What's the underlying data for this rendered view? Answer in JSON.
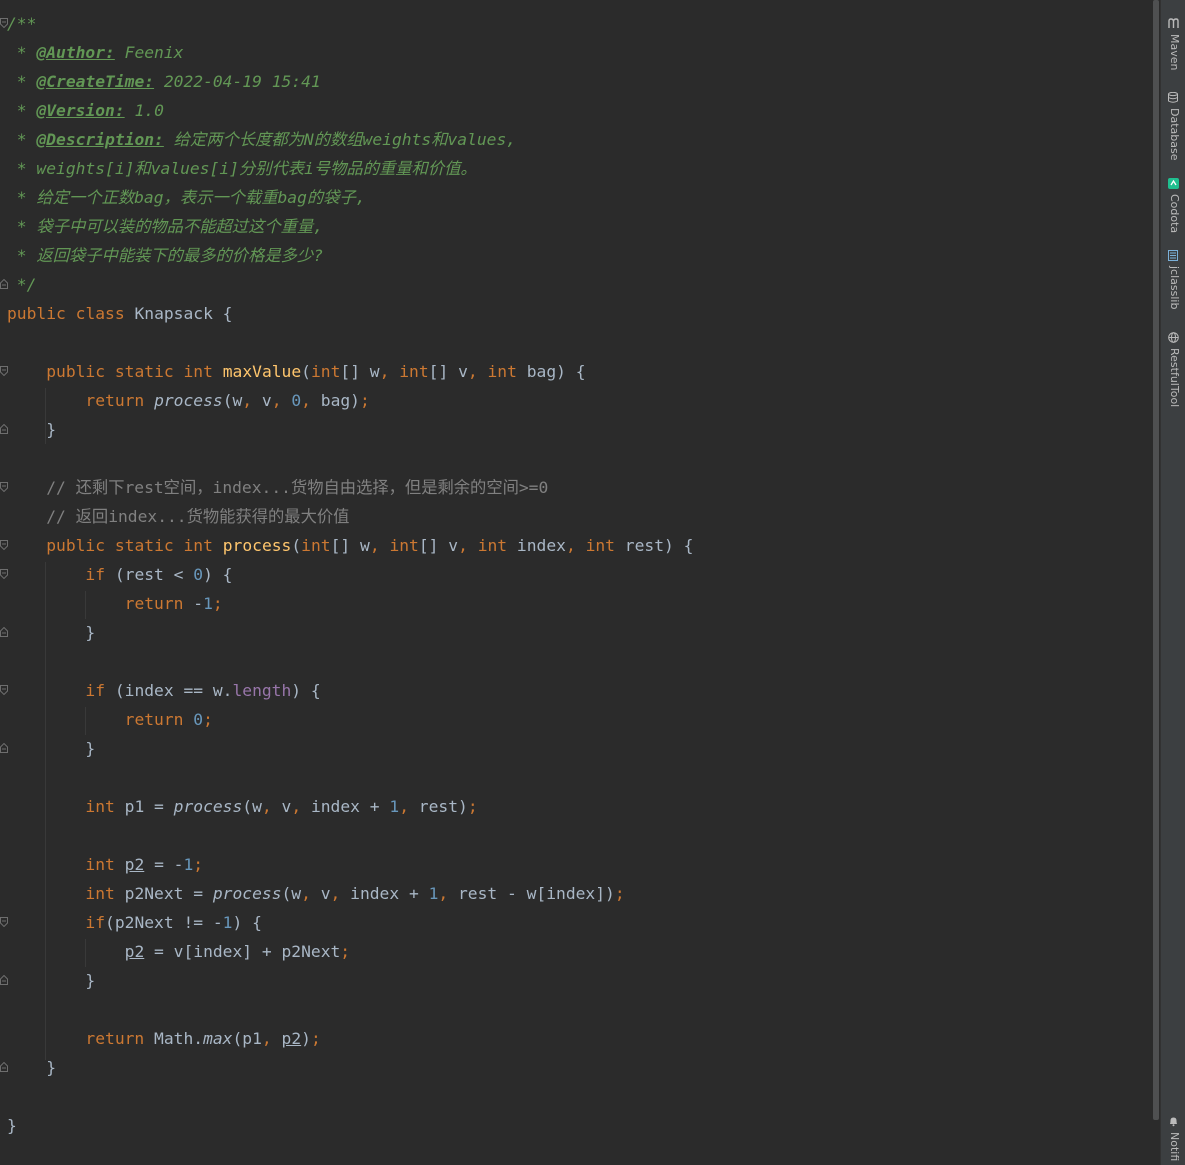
{
  "code": {
    "lines": [
      [
        [
          "/**",
          "doc"
        ]
      ],
      [
        [
          " * ",
          "doc"
        ],
        [
          "@Author:",
          "doctag"
        ],
        [
          " Feenix",
          "doc"
        ]
      ],
      [
        [
          " * ",
          "doc"
        ],
        [
          "@CreateTime:",
          "doctag"
        ],
        [
          " 2022-04-19 15:41",
          "doc"
        ]
      ],
      [
        [
          " * ",
          "doc"
        ],
        [
          "@Version:",
          "doctag"
        ],
        [
          " 1.0",
          "doc"
        ]
      ],
      [
        [
          " * ",
          "doc"
        ],
        [
          "@Description:",
          "doctag"
        ],
        [
          " 给定两个长度都为N的数组weights和values,",
          "doc"
        ]
      ],
      [
        [
          " * weights[i]和values[i]分别代表i号物品的重量和价值。",
          "doc"
        ]
      ],
      [
        [
          " * 给定一个正数bag，表示一个载重bag的袋子,",
          "doc"
        ]
      ],
      [
        [
          " * 袋子中可以装的物品不能超过这个重量,",
          "doc"
        ]
      ],
      [
        [
          " * 返回袋子中能装下的最多的价格是多少?",
          "doc"
        ]
      ],
      [
        [
          " */",
          "doc"
        ]
      ],
      [
        [
          "public",
          "kw"
        ],
        [
          " "
        ],
        [
          "class",
          "kw"
        ],
        [
          " Knapsack {"
        ]
      ],
      [],
      [
        [
          "    "
        ],
        [
          "public",
          "kw"
        ],
        [
          " "
        ],
        [
          "static",
          "kw"
        ],
        [
          " "
        ],
        [
          "int",
          "kw"
        ],
        [
          " "
        ],
        [
          "maxValue",
          "fn"
        ],
        [
          "("
        ],
        [
          "int",
          "kw"
        ],
        [
          "[] w"
        ],
        [
          ",",
          "kw"
        ],
        [
          " "
        ],
        [
          "int",
          "kw"
        ],
        [
          "[] v"
        ],
        [
          ",",
          "kw"
        ],
        [
          " "
        ],
        [
          "int",
          "kw"
        ],
        [
          " bag) {"
        ]
      ],
      [
        [
          "        "
        ],
        [
          "return",
          "kw"
        ],
        [
          " "
        ],
        [
          "process",
          "it"
        ],
        [
          "(w"
        ],
        [
          ",",
          "kw"
        ],
        [
          " v"
        ],
        [
          ",",
          "kw"
        ],
        [
          " "
        ],
        [
          "0",
          "num"
        ],
        [
          ",",
          "kw"
        ],
        [
          " bag)"
        ],
        [
          ";",
          "kw"
        ]
      ],
      [
        [
          "    }"
        ]
      ],
      [],
      [
        [
          "    "
        ],
        [
          "// 还剩下rest空间，index...货物自由选择，但是剩余的空间>=0",
          "cmt"
        ]
      ],
      [
        [
          "    "
        ],
        [
          "// 返回index...货物能获得的最大价值",
          "cmt"
        ]
      ],
      [
        [
          "    "
        ],
        [
          "public",
          "kw"
        ],
        [
          " "
        ],
        [
          "static",
          "kw"
        ],
        [
          " "
        ],
        [
          "int",
          "kw"
        ],
        [
          " "
        ],
        [
          "process",
          "fn"
        ],
        [
          "("
        ],
        [
          "int",
          "kw"
        ],
        [
          "[] w"
        ],
        [
          ",",
          "kw"
        ],
        [
          " "
        ],
        [
          "int",
          "kw"
        ],
        [
          "[] v"
        ],
        [
          ",",
          "kw"
        ],
        [
          " "
        ],
        [
          "int",
          "kw"
        ],
        [
          " index"
        ],
        [
          ",",
          "kw"
        ],
        [
          " "
        ],
        [
          "int",
          "kw"
        ],
        [
          " rest) {"
        ]
      ],
      [
        [
          "        "
        ],
        [
          "if",
          "kw"
        ],
        [
          " (rest < "
        ],
        [
          "0",
          "num"
        ],
        [
          ") {"
        ]
      ],
      [
        [
          "            "
        ],
        [
          "return",
          "kw"
        ],
        [
          " -"
        ],
        [
          "1",
          "num"
        ],
        [
          ";",
          "kw"
        ]
      ],
      [
        [
          "        }"
        ]
      ],
      [],
      [
        [
          "        "
        ],
        [
          "if",
          "kw"
        ],
        [
          " (index == w."
        ],
        [
          "length",
          "fld"
        ],
        [
          ") {"
        ]
      ],
      [
        [
          "            "
        ],
        [
          "return",
          "kw"
        ],
        [
          " "
        ],
        [
          "0",
          "num"
        ],
        [
          ";",
          "kw"
        ]
      ],
      [
        [
          "        }"
        ]
      ],
      [],
      [
        [
          "        "
        ],
        [
          "int",
          "kw"
        ],
        [
          " p1 = "
        ],
        [
          "process",
          "it"
        ],
        [
          "(w"
        ],
        [
          ",",
          "kw"
        ],
        [
          " v"
        ],
        [
          ",",
          "kw"
        ],
        [
          " index + "
        ],
        [
          "1",
          "num"
        ],
        [
          ",",
          "kw"
        ],
        [
          " rest)"
        ],
        [
          ";",
          "kw"
        ]
      ],
      [],
      [
        [
          "        "
        ],
        [
          "int",
          "kw"
        ],
        [
          " "
        ],
        [
          "p2",
          "ul"
        ],
        [
          " = -"
        ],
        [
          "1",
          "num"
        ],
        [
          ";",
          "kw"
        ]
      ],
      [
        [
          "        "
        ],
        [
          "int",
          "kw"
        ],
        [
          " p2Next = "
        ],
        [
          "process",
          "it"
        ],
        [
          "(w"
        ],
        [
          ",",
          "kw"
        ],
        [
          " v"
        ],
        [
          ",",
          "kw"
        ],
        [
          " index + "
        ],
        [
          "1",
          "num"
        ],
        [
          ",",
          "kw"
        ],
        [
          " rest - w[index])"
        ],
        [
          ";",
          "kw"
        ]
      ],
      [
        [
          "        "
        ],
        [
          "if",
          "kw"
        ],
        [
          "(p2Next != -"
        ],
        [
          "1",
          "num"
        ],
        [
          ") {"
        ]
      ],
      [
        [
          "            "
        ],
        [
          "p2",
          "ul"
        ],
        [
          " = v[index] + p2Next"
        ],
        [
          ";",
          "kw"
        ]
      ],
      [
        [
          "        }"
        ]
      ],
      [],
      [
        [
          "        "
        ],
        [
          "return",
          "kw"
        ],
        [
          " Math."
        ],
        [
          "max",
          "it"
        ],
        [
          "(p1"
        ],
        [
          ",",
          "kw"
        ],
        [
          " "
        ],
        [
          "p2",
          "ul"
        ],
        [
          ")"
        ],
        [
          ";",
          "kw"
        ]
      ],
      [
        [
          "    }"
        ]
      ],
      [],
      [
        [
          "}"
        ]
      ]
    ]
  },
  "tool_windows": [
    {
      "id": "maven",
      "label": "Maven",
      "icon": "maven-icon"
    },
    {
      "id": "database",
      "label": "Database",
      "icon": "database-icon"
    },
    {
      "id": "codota",
      "label": "Codota",
      "icon": "codota-icon"
    },
    {
      "id": "jclasslib",
      "label": "jclasslib",
      "icon": "jclasslib-icon"
    },
    {
      "id": "restfultool",
      "label": "RestfulTool",
      "icon": "globe-icon"
    },
    {
      "id": "notifications",
      "label": "Notifi",
      "icon": "bell-icon"
    }
  ],
  "colors": {
    "background": "#2b2b2b",
    "keyword": "#cc7832",
    "doc_comment": "#629755",
    "line_comment": "#808080",
    "number": "#6897bb",
    "method": "#ffc66d",
    "field": "#9876aa",
    "text": "#a9b7c6"
  }
}
